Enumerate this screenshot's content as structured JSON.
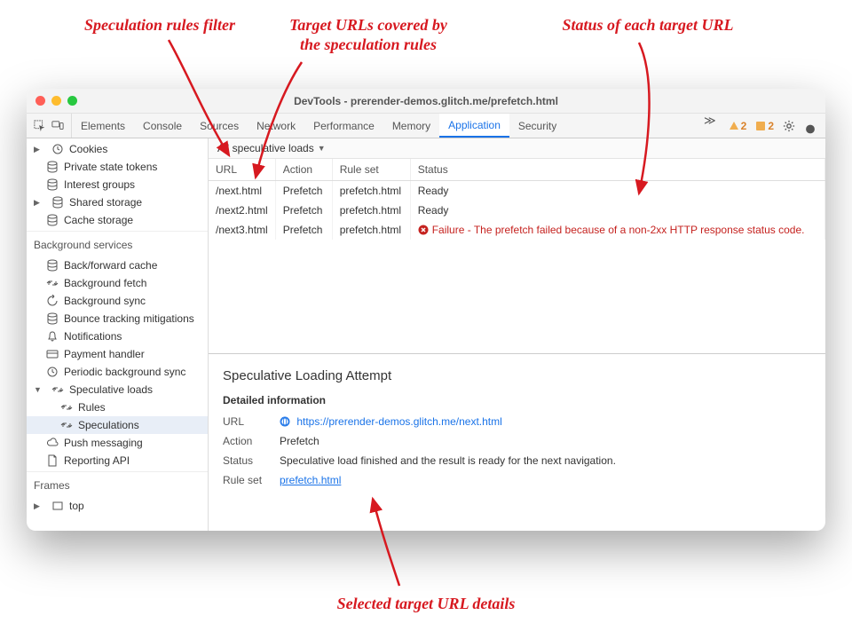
{
  "annotations": {
    "filter": "Speculation rules filter",
    "urls": "Target URLs covered by\nthe speculation rules",
    "status": "Status of each target URL",
    "details": "Selected target URL details"
  },
  "window": {
    "title": "DevTools - prerender-demos.glitch.me/prefetch.html"
  },
  "tabs": {
    "items": [
      "Elements",
      "Console",
      "Sources",
      "Network",
      "Performance",
      "Memory",
      "Application",
      "Security"
    ],
    "active": "Application",
    "warnings": "2",
    "infos": "2"
  },
  "sidebar": {
    "storage": [
      {
        "label": "Cookies",
        "icon": "clock",
        "expandable": true
      },
      {
        "label": "Private state tokens",
        "icon": "db"
      },
      {
        "label": "Interest groups",
        "icon": "db"
      },
      {
        "label": "Shared storage",
        "icon": "db",
        "expandable": true
      },
      {
        "label": "Cache storage",
        "icon": "db"
      }
    ],
    "bgHeader": "Background services",
    "bg": [
      {
        "label": "Back/forward cache",
        "icon": "db"
      },
      {
        "label": "Background fetch",
        "icon": "sync"
      },
      {
        "label": "Background sync",
        "icon": "refresh"
      },
      {
        "label": "Bounce tracking mitigations",
        "icon": "db"
      },
      {
        "label": "Notifications",
        "icon": "bell"
      },
      {
        "label": "Payment handler",
        "icon": "card"
      },
      {
        "label": "Periodic background sync",
        "icon": "clock"
      },
      {
        "label": "Speculative loads",
        "icon": "sync",
        "expandable": true,
        "open": true,
        "children": [
          {
            "label": "Rules",
            "icon": "sync"
          },
          {
            "label": "Speculations",
            "icon": "sync",
            "selected": true
          }
        ]
      },
      {
        "label": "Push messaging",
        "icon": "cloud"
      },
      {
        "label": "Reporting API",
        "icon": "doc"
      }
    ],
    "framesHeader": "Frames",
    "frames": [
      {
        "label": "top",
        "icon": "frame",
        "expandable": true
      }
    ]
  },
  "filter": {
    "label": "All speculative loads"
  },
  "table": {
    "cols": [
      "URL",
      "Action",
      "Rule set",
      "Status"
    ],
    "rows": [
      {
        "url": "/next.html",
        "action": "Prefetch",
        "ruleset": "prefetch.html",
        "status": "Ready",
        "fail": false
      },
      {
        "url": "/next2.html",
        "action": "Prefetch",
        "ruleset": "prefetch.html",
        "status": "Ready",
        "fail": false
      },
      {
        "url": "/next3.html",
        "action": "Prefetch",
        "ruleset": "prefetch.html",
        "status": "Failure - The prefetch failed because of a non-2xx HTTP response status code.",
        "fail": true
      }
    ]
  },
  "detail": {
    "heading": "Speculative Loading Attempt",
    "sub": "Detailed information",
    "urlLabel": "URL",
    "url": "https://prerender-demos.glitch.me/next.html",
    "actionLabel": "Action",
    "action": "Prefetch",
    "statusLabel": "Status",
    "status": "Speculative load finished and the result is ready for the next navigation.",
    "rulesetLabel": "Rule set",
    "ruleset": "prefetch.html"
  }
}
